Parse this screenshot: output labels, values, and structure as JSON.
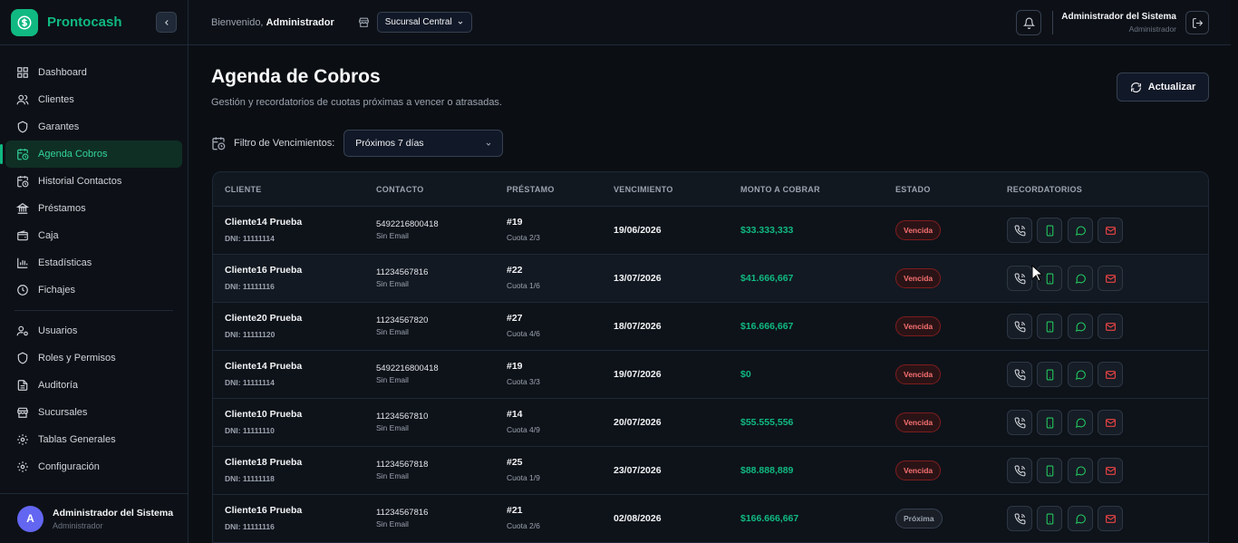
{
  "brand": {
    "name": "Prontocash"
  },
  "sidebar": {
    "items": [
      {
        "label": "Dashboard",
        "icon": "grid-icon"
      },
      {
        "label": "Clientes",
        "icon": "users-icon"
      },
      {
        "label": "Garantes",
        "icon": "shield-icon"
      },
      {
        "label": "Agenda Cobros",
        "icon": "calendar-clock-icon",
        "active": true
      },
      {
        "label": "Historial Contactos",
        "icon": "history-icon"
      },
      {
        "label": "Préstamos",
        "icon": "bank-icon"
      },
      {
        "label": "Caja",
        "icon": "wallet-icon"
      },
      {
        "label": "Estadísticas",
        "icon": "bar-chart-icon"
      },
      {
        "label": "Fichajes",
        "icon": "clock-icon"
      }
    ],
    "admin_items": [
      {
        "label": "Usuarios",
        "icon": "user-gear-icon"
      },
      {
        "label": "Roles y Permisos",
        "icon": "shield-icon"
      },
      {
        "label": "Auditoría",
        "icon": "file-icon"
      },
      {
        "label": "Sucursales",
        "icon": "store-icon"
      },
      {
        "label": "Tablas Generales",
        "icon": "gear-icon"
      },
      {
        "label": "Configuración",
        "icon": "gear-icon"
      }
    ],
    "user": {
      "initial": "A",
      "name": "Administrador del Sistema",
      "role": "Administrador"
    }
  },
  "topbar": {
    "welcome_prefix": "Bienvenido,",
    "welcome_name": "Administrador",
    "branch": "Sucursal Central",
    "user_name": "Administrador del Sistema",
    "user_role": "Administrador"
  },
  "page": {
    "title": "Agenda de Cobros",
    "subtitle": "Gestión y recordatorios de cuotas próximas a vencer o atrasadas.",
    "refresh_label": "Actualizar",
    "filter_label": "Filtro de Vencimientos:",
    "filter_value": "Próximos 7 días"
  },
  "table": {
    "headers": [
      "CLIENTE",
      "CONTACTO",
      "PRÉSTAMO",
      "VENCIMIENTO",
      "MONTO A COBRAR",
      "ESTADO",
      "RECORDATORIOS"
    ],
    "rows": [
      {
        "name": "Cliente14 Prueba",
        "dni": "DNI: 11111114",
        "phone": "5492216800418",
        "email": "Sin Email",
        "loan": "#19",
        "cuota": "Cuota 2/3",
        "venc": "19/06/2026",
        "monto": "$33.333,333",
        "estado": "Vencida"
      },
      {
        "name": "Cliente16 Prueba",
        "dni": "DNI: 11111116",
        "phone": "11234567816",
        "email": "Sin Email",
        "loan": "#22",
        "cuota": "Cuota 1/6",
        "venc": "13/07/2026",
        "monto": "$41.666,667",
        "estado": "Vencida"
      },
      {
        "name": "Cliente20 Prueba",
        "dni": "DNI: 11111120",
        "phone": "11234567820",
        "email": "Sin Email",
        "loan": "#27",
        "cuota": "Cuota 4/6",
        "venc": "18/07/2026",
        "monto": "$16.666,667",
        "estado": "Vencida"
      },
      {
        "name": "Cliente14 Prueba",
        "dni": "DNI: 11111114",
        "phone": "5492216800418",
        "email": "Sin Email",
        "loan": "#19",
        "cuota": "Cuota 3/3",
        "venc": "19/07/2026",
        "monto": "$0",
        "estado": "Vencida"
      },
      {
        "name": "Cliente10 Prueba",
        "dni": "DNI: 11111110",
        "phone": "11234567810",
        "email": "Sin Email",
        "loan": "#14",
        "cuota": "Cuota 4/9",
        "venc": "20/07/2026",
        "monto": "$55.555,556",
        "estado": "Vencida"
      },
      {
        "name": "Cliente18 Prueba",
        "dni": "DNI: 11111118",
        "phone": "11234567818",
        "email": "Sin Email",
        "loan": "#25",
        "cuota": "Cuota 1/9",
        "venc": "23/07/2026",
        "monto": "$88.888,889",
        "estado": "Vencida"
      },
      {
        "name": "Cliente16 Prueba",
        "dni": "DNI: 11111116",
        "phone": "11234567816",
        "email": "Sin Email",
        "loan": "#21",
        "cuota": "Cuota 2/6",
        "venc": "02/08/2026",
        "monto": "$166.666,667",
        "estado": "Próxima"
      }
    ]
  },
  "colors": {
    "accent": "#10b981",
    "danger": "#f87171",
    "background": "#0b0f14"
  }
}
